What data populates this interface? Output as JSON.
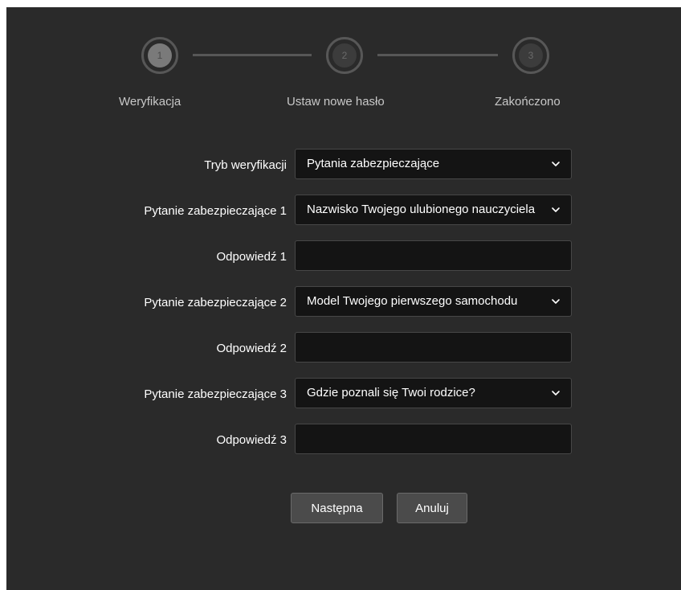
{
  "stepper": {
    "steps": [
      {
        "number": "1",
        "label": "Weryfikacja",
        "state": "active"
      },
      {
        "number": "2",
        "label": "Ustaw nowe hasło",
        "state": "inactive"
      },
      {
        "number": "3",
        "label": "Zakończono",
        "state": "inactive"
      }
    ]
  },
  "form": {
    "verification_mode": {
      "label": "Tryb weryfikacji",
      "value": "Pytania zabezpieczające"
    },
    "question1": {
      "label": "Pytanie zabezpieczające 1",
      "value": "Nazwisko Twojego ulubionego nauczyciela"
    },
    "answer1": {
      "label": "Odpowiedź 1",
      "value": "",
      "placeholder": ""
    },
    "question2": {
      "label": "Pytanie zabezpieczające 2",
      "value": "Model Twojego pierwszego samochodu"
    },
    "answer2": {
      "label": "Odpowiedź 2",
      "value": "",
      "placeholder": ""
    },
    "question3": {
      "label": "Pytanie zabezpieczające 3",
      "value": "Gdzie poznali się Twoi rodzice?"
    },
    "answer3": {
      "label": "Odpowiedź 3",
      "value": "",
      "placeholder": ""
    }
  },
  "buttons": {
    "next_label": "Następna",
    "cancel_label": "Anuluj"
  },
  "icons": {
    "dropdown": "chevron-down-icon"
  },
  "colors": {
    "background": "#2a2a2a",
    "field_background": "#141414",
    "button_background": "#4b4b4b",
    "step_active": "#7a7a7a",
    "step_inactive": "#3c3c3c"
  }
}
